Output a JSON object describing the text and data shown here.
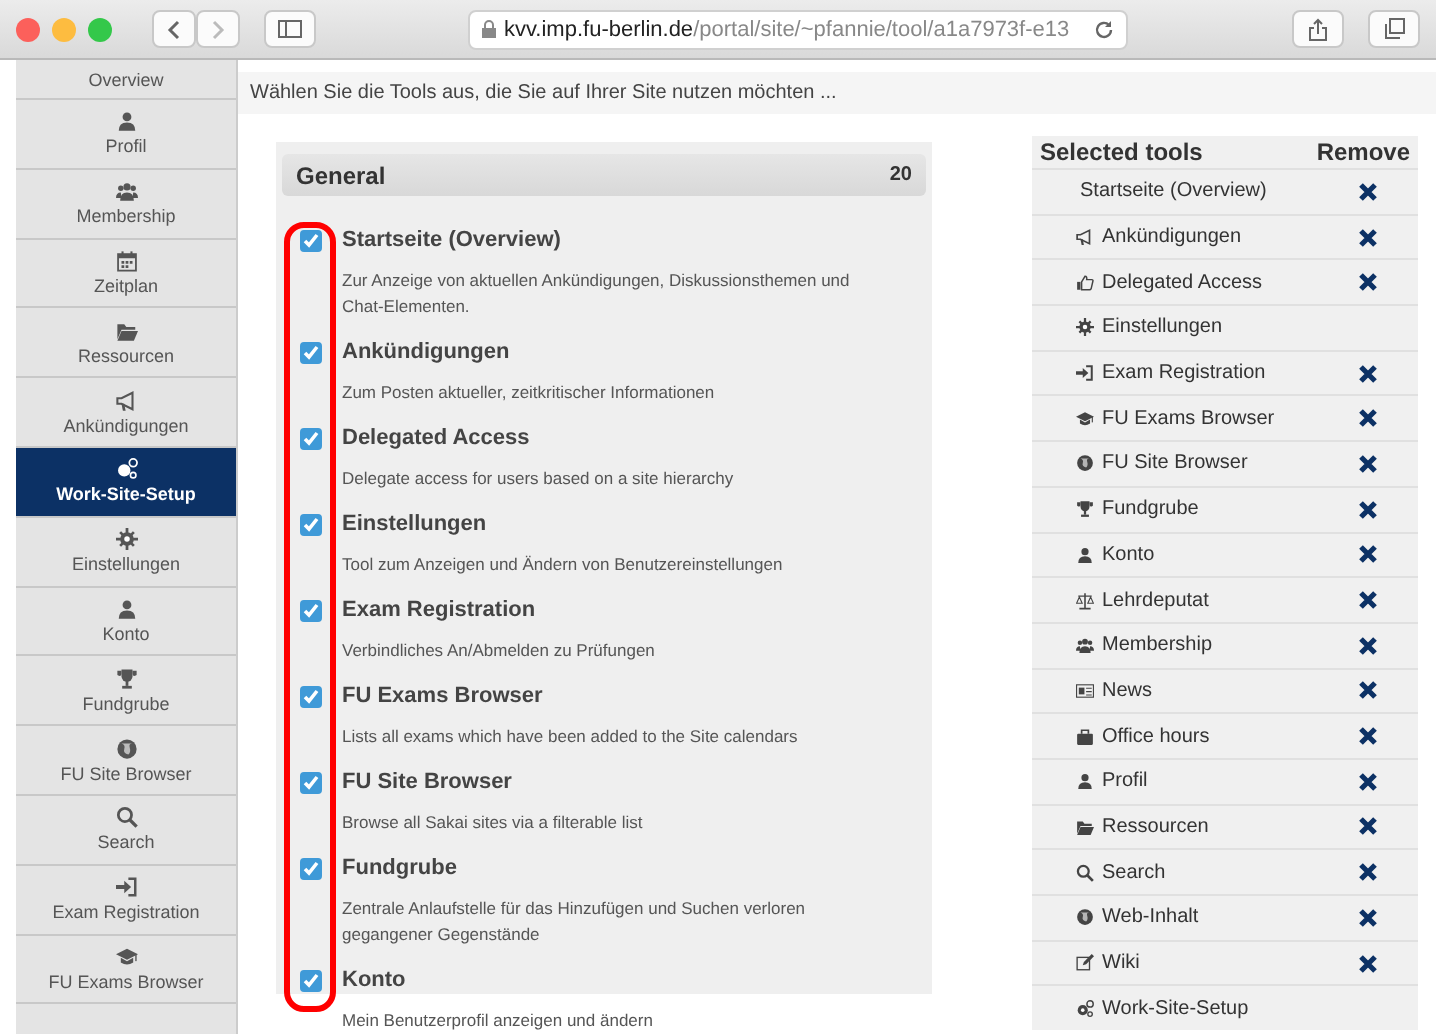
{
  "browser": {
    "url_host": "kvv.imp.fu-berlin.de",
    "url_path": "/portal/site/~pfannie/tool/a1a7973f-e13"
  },
  "sidebar": {
    "items": [
      {
        "label": "Overview",
        "selected": false
      },
      {
        "label": "Profil",
        "selected": false
      },
      {
        "label": "Membership",
        "selected": false
      },
      {
        "label": "Zeitplan",
        "selected": false
      },
      {
        "label": "Ressourcen",
        "selected": false
      },
      {
        "label": "Ankündigungen",
        "selected": false
      },
      {
        "label": "Work-Site-Setup",
        "selected": true
      },
      {
        "label": "Einstellungen",
        "selected": false
      },
      {
        "label": "Konto",
        "selected": false
      },
      {
        "label": "Fundgrube",
        "selected": false
      },
      {
        "label": "FU Site Browser",
        "selected": false
      },
      {
        "label": "Search",
        "selected": false
      },
      {
        "label": "Exam Registration",
        "selected": false
      },
      {
        "label": "FU Exams Browser",
        "selected": false
      }
    ]
  },
  "instructions": "Wählen Sie die Tools aus, die Sie auf Ihrer Site nutzen möchten ...",
  "group": {
    "title": "General",
    "count": "20",
    "tools": [
      {
        "name": "Startseite (Overview)",
        "description": "Zur Anzeige von aktuellen Ankündigungen, Diskussionsthemen und Chat-Elementen.",
        "checked": true
      },
      {
        "name": "Ankündigungen",
        "description": "Zum Posten aktueller, zeitkritischer Informationen",
        "checked": true
      },
      {
        "name": "Delegated Access",
        "description": "Delegate access for users based on a site hierarchy",
        "checked": true
      },
      {
        "name": "Einstellungen",
        "description": "Tool zum Anzeigen und Ändern von Benutzereinstellungen",
        "checked": true
      },
      {
        "name": "Exam Registration",
        "description": "Verbindliches An/Abmelden zu Prüfungen",
        "checked": true
      },
      {
        "name": "FU Exams Browser",
        "description": "Lists all exams which have been added to the Site calendars",
        "checked": true
      },
      {
        "name": "FU Site Browser",
        "description": "Browse all Sakai sites via a filterable list",
        "checked": true
      },
      {
        "name": "Fundgrube",
        "description": "Zentrale Anlaufstelle für das Hinzufügen und Suchen verloren gegangener Gegenstände",
        "checked": true
      },
      {
        "name": "Konto",
        "description": "Mein Benutzerprofil anzeigen und ändern",
        "checked": true
      }
    ]
  },
  "selected_tools": {
    "columns": [
      "Selected tools",
      "Remove"
    ],
    "rows": [
      {
        "name": "Startseite (Overview)",
        "removable": true
      },
      {
        "name": "Ankündigungen",
        "removable": true
      },
      {
        "name": "Delegated Access",
        "removable": true
      },
      {
        "name": "Einstellungen",
        "removable": false
      },
      {
        "name": "Exam Registration",
        "removable": true
      },
      {
        "name": "FU Exams Browser",
        "removable": true
      },
      {
        "name": "FU Site Browser",
        "removable": true
      },
      {
        "name": "Fundgrube",
        "removable": true
      },
      {
        "name": "Konto",
        "removable": true
      },
      {
        "name": "Lehrdeputat",
        "removable": true
      },
      {
        "name": "Membership",
        "removable": true
      },
      {
        "name": "News",
        "removable": true
      },
      {
        "name": "Office hours",
        "removable": true
      },
      {
        "name": "Profil",
        "removable": true
      },
      {
        "name": "Ressourcen",
        "removable": true
      },
      {
        "name": "Search",
        "removable": true
      },
      {
        "name": "Web-Inhalt",
        "removable": true
      },
      {
        "name": "Wiki",
        "removable": true
      },
      {
        "name": "Work-Site-Setup",
        "removable": false
      }
    ]
  }
}
